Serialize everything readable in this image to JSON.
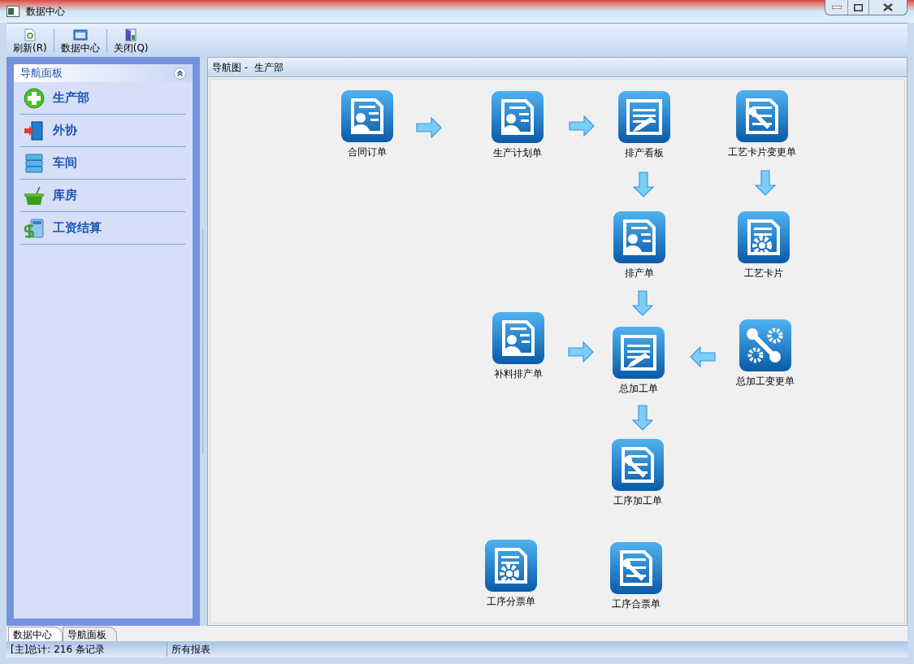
{
  "window": {
    "title": "数据中心"
  },
  "toolbar": [
    {
      "label": "刷新(R)"
    },
    {
      "label": "数据中心"
    },
    {
      "label": "关闭(Q)"
    }
  ],
  "sidebar": {
    "title": "导航面板",
    "items": [
      {
        "label": "生产部"
      },
      {
        "label": "外协"
      },
      {
        "label": "车间"
      },
      {
        "label": "库房"
      },
      {
        "label": "工资结算"
      }
    ]
  },
  "content": {
    "breadcrumb": "导航图 -  生产部",
    "nodes": [
      {
        "label": "合同订单"
      },
      {
        "label": "生产计划单"
      },
      {
        "label": "排产看板"
      },
      {
        "label": "工艺卡片变更单"
      },
      {
        "label": "排产单"
      },
      {
        "label": "工艺卡片"
      },
      {
        "label": "补料排产单"
      },
      {
        "label": "总加工单"
      },
      {
        "label": "总加工变更单"
      },
      {
        "label": "工序加工单"
      },
      {
        "label": "工序分票单"
      },
      {
        "label": "工序合票单"
      }
    ]
  },
  "bottom_tabs": [
    {
      "label": "数据中心",
      "selected": true
    },
    {
      "label": "导航面板",
      "selected": false
    }
  ],
  "status_bar": [
    "[主]总计: 216 条记录",
    "所有报表"
  ]
}
